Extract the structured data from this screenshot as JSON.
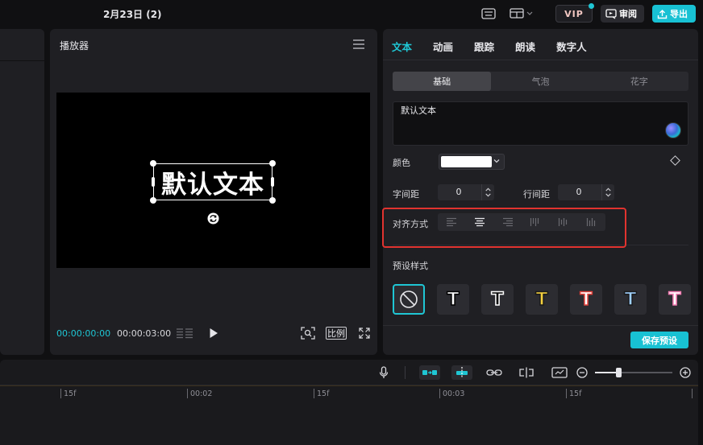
{
  "topbar": {
    "title": "2月23日 (2)",
    "vip_label": "VIP",
    "review_label": "审阅",
    "export_label": "导出"
  },
  "player": {
    "title": "播放器",
    "canvas_text": "默认文本",
    "current_time": "00:00:00:00",
    "total_time": "00:00:03:00",
    "ratio_label": "比例"
  },
  "props": {
    "tabs": [
      {
        "label": "文本",
        "active": true
      },
      {
        "label": "动画",
        "active": false
      },
      {
        "label": "跟踪",
        "active": false
      },
      {
        "label": "朗读",
        "active": false
      },
      {
        "label": "数字人",
        "active": false
      }
    ],
    "segments": [
      {
        "label": "基础",
        "active": true
      },
      {
        "label": "气泡",
        "active": false
      },
      {
        "label": "花字",
        "active": false
      }
    ],
    "text_value": "默认文本",
    "color_label": "颜色",
    "color_value": "#ffffff",
    "letter_spacing_label": "字间距",
    "letter_spacing_value": "0",
    "line_spacing_label": "行间距",
    "line_spacing_value": "0",
    "align_label": "对齐方式",
    "align_options": [
      "align-left-icon",
      "align-center-icon",
      "align-right-icon",
      "vertical-align-top-icon",
      "vertical-align-middle-icon",
      "vertical-align-bottom-icon"
    ],
    "preset_title": "预设样式",
    "presets": [
      {
        "glyph": "",
        "fill": "",
        "stroke": ""
      },
      {
        "glyph": "T",
        "fill": "#ffffff",
        "stroke": "#000000"
      },
      {
        "glyph": "T",
        "fill": "#000000",
        "stroke": "#ffffff"
      },
      {
        "glyph": "T",
        "fill": "#f4d03f",
        "stroke": "#1a1a1a"
      },
      {
        "glyph": "T",
        "fill": "#ffffff",
        "stroke": "#e0413a"
      },
      {
        "glyph": "T",
        "fill": "#9fd0ff",
        "stroke": "#1a1a1a"
      },
      {
        "glyph": "T",
        "fill": "#ffffff",
        "stroke": "#f07ab0"
      }
    ],
    "save_preset_label": "保存预设"
  },
  "timeline": {
    "ruler_labels": [
      "15f",
      "00:02",
      "15f",
      "00:03",
      "15f"
    ]
  },
  "colors": {
    "accent": "#1fc6d4",
    "highlight": "#e1332f"
  }
}
